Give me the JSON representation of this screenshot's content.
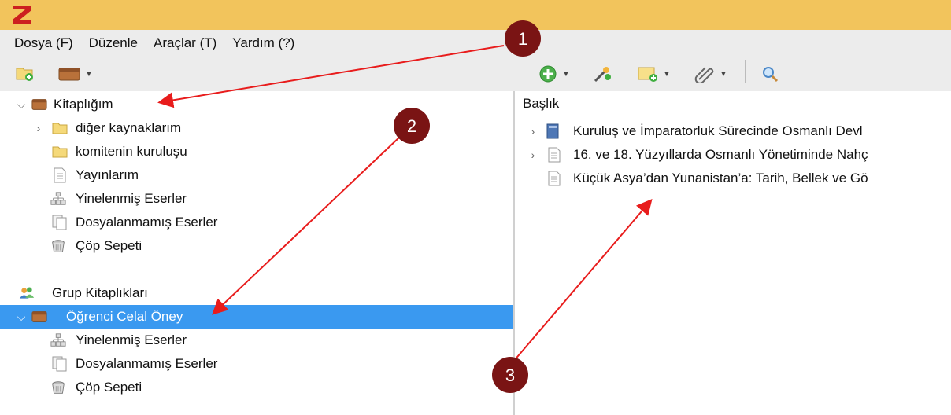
{
  "menu": [
    "Dosya (F)",
    "Düzenle",
    "Araçlar (T)",
    "Yardım (?)"
  ],
  "tree": {
    "my_library": "Kitaplığım",
    "items": [
      {
        "label": "diğer kaynaklarım",
        "icon": "folder-icon"
      },
      {
        "label": "komitenin kuruluşu",
        "icon": "folder-icon"
      },
      {
        "label": "Yayınlarım",
        "icon": "document-icon"
      },
      {
        "label": "Yinelenmiş Eserler",
        "icon": "duplicate-icon"
      },
      {
        "label": "Dosyalanmamış Eserler",
        "icon": "unfiled-icon"
      },
      {
        "label": "Çöp Sepeti",
        "icon": "trash-icon"
      }
    ],
    "group_header": "Grup Kitaplıkları",
    "group_library": "Öğrenci Celal Öney",
    "group_items": [
      {
        "label": "Yinelenmiş Eserler",
        "icon": "duplicate-icon"
      },
      {
        "label": "Dosyalanmamış Eserler",
        "icon": "unfiled-icon"
      },
      {
        "label": "Çöp Sepeti",
        "icon": "trash-icon"
      }
    ]
  },
  "items_pane": {
    "column_title": "Başlık",
    "rows": [
      {
        "title": "Kuruluş ve İmparatorluk Sürecinde Osmanlı Devl",
        "icon": "book-icon"
      },
      {
        "title": "16. ve 18. Yüzyıllarda Osmanlı Yönetiminde Nahç",
        "icon": "document-icon"
      },
      {
        "title": "Küçük Asya’dan Yunanistan’a: Tarih, Bellek ve Gö",
        "icon": "document-icon"
      }
    ]
  },
  "annotations": [
    "1",
    "2",
    "3"
  ],
  "colors": {
    "title_bar": "#f2c45c",
    "logo_red": "#cc1f1f",
    "selection": "#3a99f0",
    "arrow": "#e81c1c",
    "badge": "#7a1414"
  }
}
